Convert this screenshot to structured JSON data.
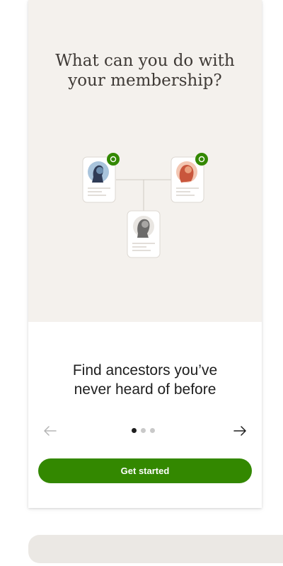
{
  "hero": {
    "title_line1": "What can you do with",
    "title_line2": "your membership?",
    "background": "#f4f1ed"
  },
  "illustration": {
    "badge_icon": "leaf-icon",
    "badge_color": "#338800",
    "person_colors": [
      "#a9c4dc",
      "#eaa07e",
      "#d8d5d2"
    ]
  },
  "slide": {
    "headline_line1": "Find ancestors you’ve",
    "headline_line2": "never heard of before"
  },
  "pager": {
    "prev_icon": "arrow-left-icon",
    "next_icon": "arrow-right-icon",
    "total": 3,
    "active_index": 0
  },
  "cta": {
    "label": "Get started",
    "color": "#338800"
  }
}
